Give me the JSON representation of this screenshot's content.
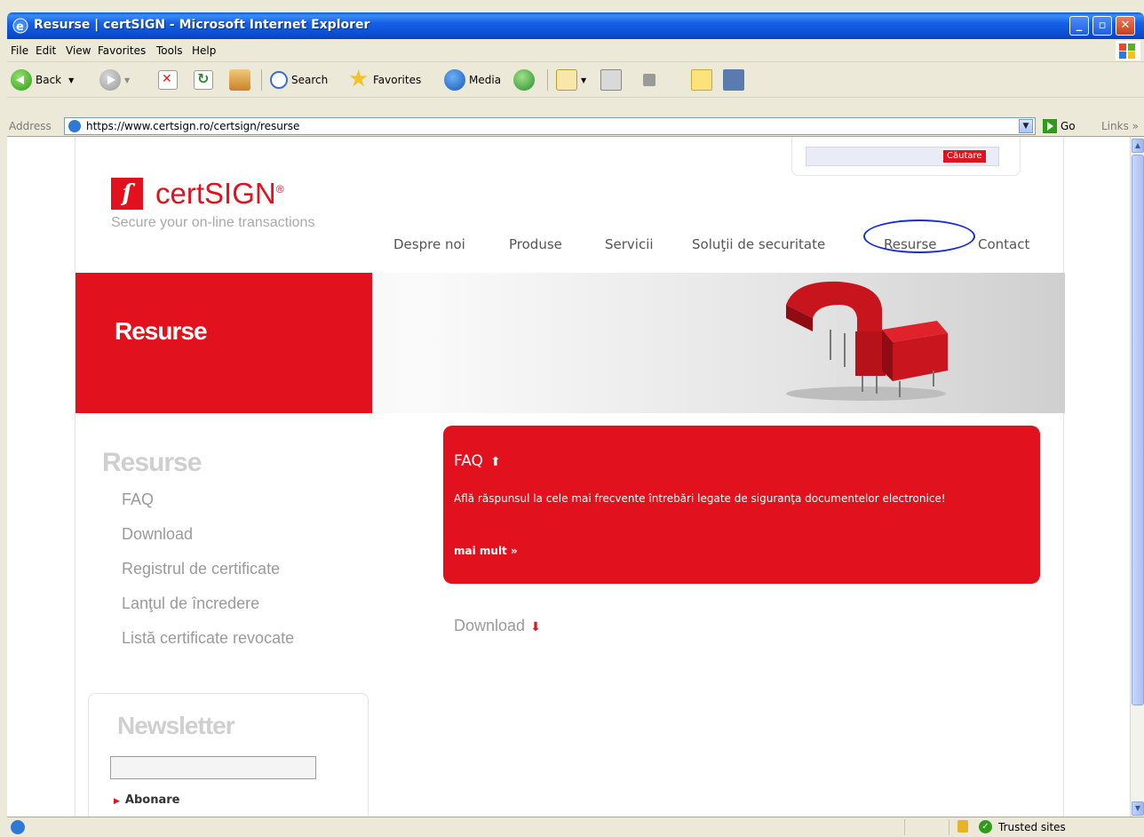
{
  "window": {
    "title": "Resurse | certSIGN - Microsoft Internet Explorer",
    "controls": [
      "minimize",
      "maximize",
      "close"
    ]
  },
  "menu": [
    "File",
    "Edit",
    "View",
    "Favorites",
    "Tools",
    "Help"
  ],
  "toolbar": {
    "back": "Back",
    "search": "Search",
    "favorites": "Favorites",
    "media": "Media"
  },
  "address": {
    "label": "Address",
    "url": "https://www.certsign.ro/certsign/resurse",
    "go": "Go",
    "links": "Links"
  },
  "site": {
    "search_button": "Căutare",
    "logo_name": "certSIGN",
    "logo_mark": "ſ",
    "tagline": "Secure your on-line transactions",
    "nav": [
      "Despre noi",
      "Produse",
      "Servicii",
      "Soluţii de securitate",
      "Resurse",
      "Contact"
    ],
    "hero_title": "Resurse",
    "sidebar": {
      "title": "Resurse",
      "items": [
        "FAQ",
        "Download",
        "Registrul de certificate",
        "Lanţul de încredere",
        "Listă certificate revocate"
      ]
    },
    "newsletter": {
      "title": "Newsletter",
      "subscribe": "Abonare"
    },
    "faq": {
      "title": "FAQ",
      "description": "Află răspunsul la cele mai frecvente întrebări legate de siguranţa documentelor electronice!",
      "more": "mai mult »"
    },
    "download_title": "Download"
  },
  "status": {
    "zone": "Trusted sites"
  },
  "colors": {
    "brand_red": "#e1121e",
    "xp_blue": "#0b4fd3",
    "highlight_ellipse": "#1a2bd6"
  }
}
